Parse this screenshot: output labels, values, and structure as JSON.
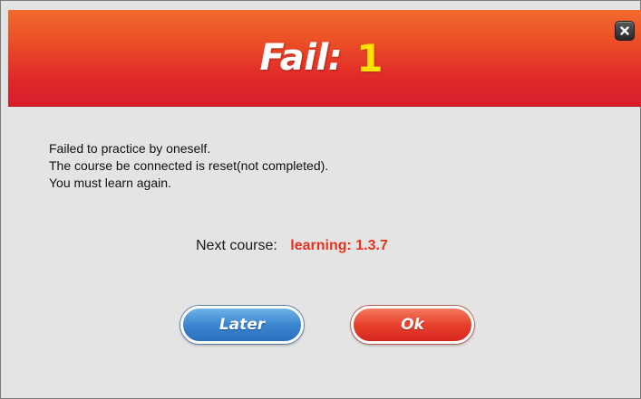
{
  "header": {
    "title_label": "Fail:",
    "fail_count": "1",
    "close_icon": "close-icon"
  },
  "message": {
    "lines": [
      "Failed to practice by oneself.",
      "The course be connected is reset(not completed).",
      "You must learn again."
    ]
  },
  "next_course": {
    "label": "Next course:",
    "value": "learning: 1.3.7"
  },
  "buttons": {
    "later_label": "Later",
    "ok_label": "Ok"
  },
  "colors": {
    "header_top": "#f26a2c",
    "header_bottom": "#d81d2a",
    "count_yellow": "#ffe100",
    "next_course_red": "#e8311f",
    "later_blue": "#3a86d0",
    "ok_red": "#e8402c",
    "body_gray": "#e4e4e4"
  }
}
